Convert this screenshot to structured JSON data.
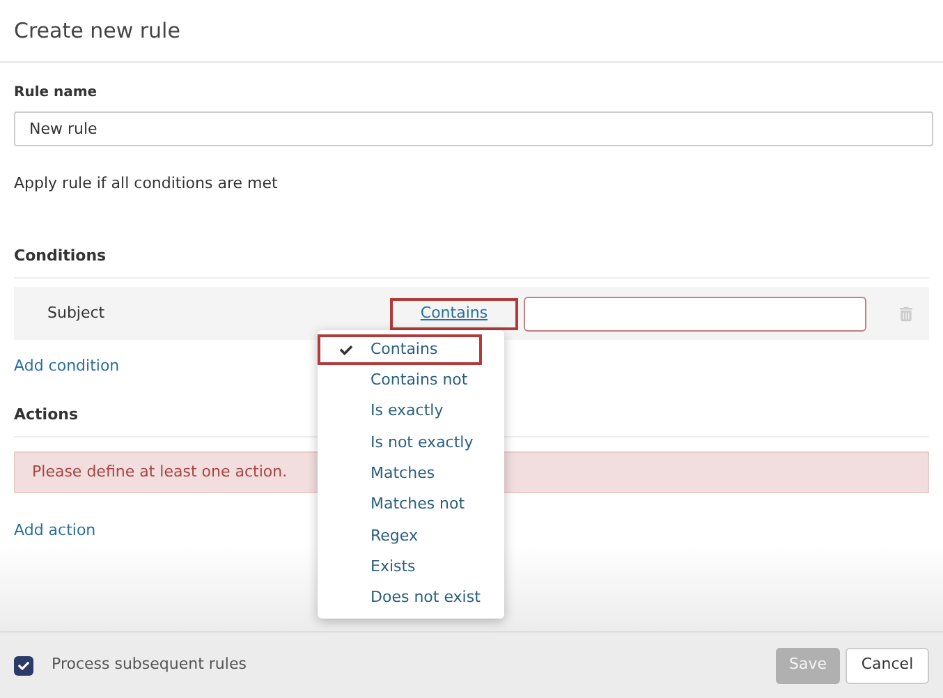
{
  "dialog": {
    "title": "Create new rule"
  },
  "rule_name": {
    "label": "Rule name",
    "value": "New rule"
  },
  "apply_text": "Apply rule if all conditions are met",
  "conditions": {
    "heading": "Conditions",
    "rows": [
      {
        "field": "Subject",
        "operator": "Contains",
        "operator_highlighted": true,
        "value_invalid": true
      }
    ],
    "add_link": "Add condition"
  },
  "operator_menu": {
    "open": true,
    "options": [
      {
        "label": "Contains",
        "selected": true,
        "highlighted": true
      },
      {
        "label": "Contains not",
        "selected": false,
        "highlighted": false
      },
      {
        "label": "Is exactly",
        "selected": false,
        "highlighted": false
      },
      {
        "label": "Is not exactly",
        "selected": false,
        "highlighted": false
      },
      {
        "label": "Matches",
        "selected": false,
        "highlighted": false
      },
      {
        "label": "Matches not",
        "selected": false,
        "highlighted": false
      },
      {
        "label": "Regex",
        "selected": false,
        "highlighted": false
      },
      {
        "label": "Exists",
        "selected": false,
        "highlighted": false
      },
      {
        "label": "Does not exist",
        "selected": false,
        "highlighted": false
      }
    ]
  },
  "actions": {
    "heading": "Actions",
    "error": "Please define at least one action.",
    "add_link": "Add action"
  },
  "footer": {
    "process_subsequent": {
      "label": "Process subsequent rules",
      "checked": true
    },
    "buttons": [
      {
        "label": "Save",
        "disabled": true
      },
      {
        "label": "Cancel",
        "disabled": false
      }
    ]
  }
}
